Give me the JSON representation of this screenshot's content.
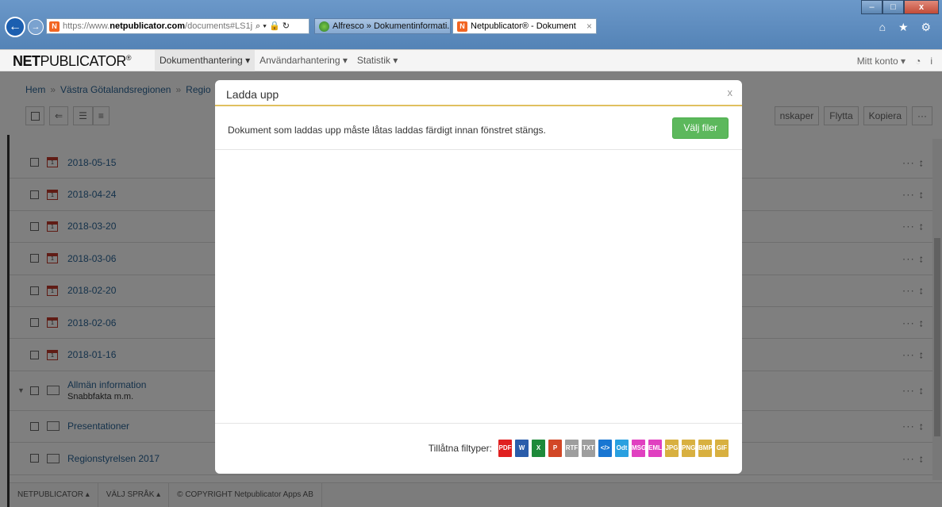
{
  "browser": {
    "url_scheme": "https://www.",
    "url_host": "netpublicator.com",
    "url_rest": "/documents#LS1j",
    "addr_tools": "⌕ ▾ 🔒 ↻",
    "tabs": [
      {
        "label": "Alfresco » Dokumentinformati..."
      },
      {
        "label": "Netpublicator® - Dokument"
      }
    ],
    "tab_close": "×",
    "window": {
      "min": "–",
      "max": "□",
      "close": "x"
    },
    "nav_back": "←",
    "nav_fwd": "→",
    "toolbar_icons": "⌂ ★ ⚙"
  },
  "app": {
    "logo_bold": "NET",
    "logo_rest": "PUBLICATOR",
    "logo_mark": "®",
    "menu": [
      {
        "label": "Dokumenthantering ▾"
      },
      {
        "label": "Användarhantering ▾"
      },
      {
        "label": "Statistik ▾"
      }
    ],
    "account": "Mitt konto ▾",
    "gauge_icon": "◔",
    "info_icon": "i"
  },
  "breadcrumb": {
    "items": [
      "Hem",
      "Västra Götalandsregionen",
      "Regio"
    ],
    "sep": "»"
  },
  "toolbar": {
    "back": "⇐",
    "list_a": "☰",
    "list_b": "≡",
    "right": [
      "nskaper",
      "Flytta",
      "Kopiera",
      "···"
    ]
  },
  "rows": [
    {
      "label": "2018-05-15",
      "type": "calendar"
    },
    {
      "label": "2018-04-24",
      "type": "calendar"
    },
    {
      "label": "2018-03-20",
      "type": "calendar"
    },
    {
      "label": "2018-03-06",
      "type": "calendar"
    },
    {
      "label": "2018-02-20",
      "type": "calendar"
    },
    {
      "label": "2018-02-06",
      "type": "calendar"
    },
    {
      "label": "2018-01-16",
      "type": "calendar"
    },
    {
      "label": "Allmän information",
      "sub": "Snabbfakta m.m.",
      "type": "folder"
    },
    {
      "label": "Presentationer",
      "type": "folder"
    },
    {
      "label": "Regionstyrelsen 2017",
      "type": "folder"
    }
  ],
  "row_actions": "··· ↕",
  "calendar_day": "1",
  "expander": "▼",
  "footer": [
    "NETPUBLICATOR ▴",
    "VÄLJ SPRÅK ▴",
    "© COPYRIGHT Netpublicator Apps AB"
  ],
  "modal": {
    "title": "Ladda upp",
    "close": "x",
    "message": "Dokument som laddas upp måste låtas laddas färdigt innan fönstret stängs.",
    "select_button": "Välj filer",
    "allowed_label": "Tillåtna filtyper:",
    "filetypes": [
      {
        "label": "PDF",
        "color": "#e02020"
      },
      {
        "label": "W",
        "color": "#2a5caa"
      },
      {
        "label": "X",
        "color": "#1e8a3a"
      },
      {
        "label": "P",
        "color": "#d24726"
      },
      {
        "label": "RTF",
        "color": "#9e9e9e"
      },
      {
        "label": "TXT",
        "color": "#9e9e9e"
      },
      {
        "label": "</>",
        "color": "#1976d2"
      },
      {
        "label": "Odt",
        "color": "#29a0e0"
      },
      {
        "label": "MSG",
        "color": "#e040c0"
      },
      {
        "label": "EML",
        "color": "#e040c0"
      },
      {
        "label": "JPG",
        "color": "#d8b040"
      },
      {
        "label": "PNG",
        "color": "#d8b040"
      },
      {
        "label": "BMP",
        "color": "#d8b040"
      },
      {
        "label": "GIF",
        "color": "#d8b040"
      }
    ]
  },
  "colors": {
    "accent_green": "#5cb85c",
    "link_blue": "#2a6496",
    "header_rule": "#e0c060"
  }
}
